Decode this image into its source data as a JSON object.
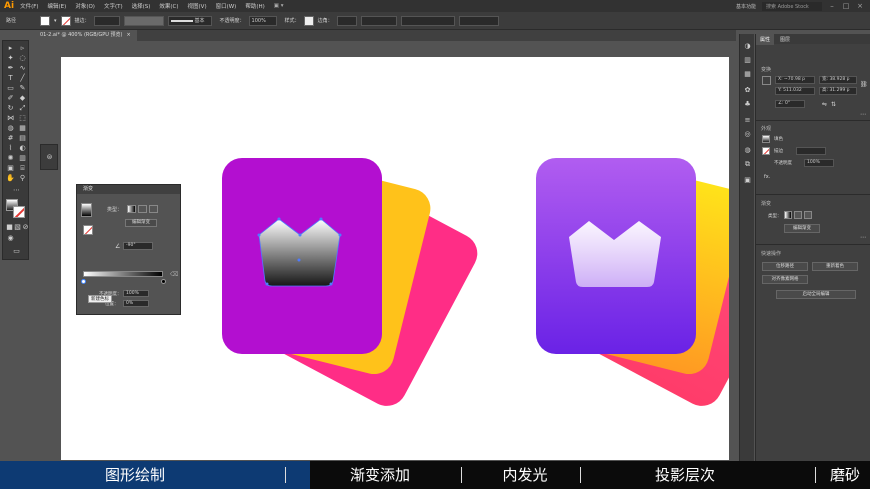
{
  "app": {
    "logo": "Ai"
  },
  "menubar": {
    "items": [
      "文件(F)",
      "编辑(E)",
      "对象(O)",
      "文字(T)",
      "选择(S)",
      "效果(C)",
      "视图(V)",
      "窗口(W)",
      "帮助(H)"
    ],
    "workspace": "基本功能",
    "search_placeholder": "搜索 Adobe Stock"
  },
  "control_bar": {
    "selection_label": "路径",
    "stroke_label": "描边：",
    "stroke_style": "基本",
    "opacity_label": "不透明度：",
    "opacity_value": "100%",
    "style_label": "样式：",
    "corner_label": "边角：",
    "fill_color": "#ffffff",
    "stroke_color": "#e53935"
  },
  "document": {
    "tab_label": "01-2.ai* @ 400% (RGB/GPU 预览)",
    "close": "×"
  },
  "gradient_panel": {
    "title": "渐变",
    "type_label": "类型：",
    "edit_button": "编辑渐变",
    "angle_label": "∠",
    "angle_value": "-90°",
    "opacity_label": "不透明度：",
    "opacity_value": "100%",
    "location_label": "位置：",
    "location_value": "0%",
    "tooltip": "新建色标",
    "stops": [
      "#ffffff",
      "#000000"
    ]
  },
  "properties_panel": {
    "tabs": [
      "属性",
      "图层"
    ],
    "section_transform": "变换",
    "x": "X: ~70.98 p",
    "y": "Y: 511.032",
    "w": "宽: 38.928 p",
    "h": "高: 31.299 p",
    "angle": "∠: 0°",
    "section_appearance": "外观",
    "fill_label": "填色",
    "stroke_label": "描边",
    "opacity_label": "不透明度",
    "opacity_value": "100%",
    "fx": "fx.",
    "section_gradient": "渐变",
    "gradient_type": "类型：",
    "gradient_edit": "编辑渐变",
    "section_quick": "快速操作",
    "buttons": [
      "位移路径",
      "重新着色",
      "对齐像素网格",
      "启动全局编辑"
    ]
  },
  "artwork": {
    "card_left_color": "#b30fd0",
    "card_yellow": "#ffc21a",
    "card_pink": "#ff2d86",
    "card_right_top": "#b15df0",
    "card_right_bottom": "#6a22e6"
  },
  "footer": {
    "steps": [
      "图形绘制",
      "渐变添加",
      "内发光",
      "投影层次",
      "磨砂"
    ],
    "active_bg": "#0d3a73"
  }
}
